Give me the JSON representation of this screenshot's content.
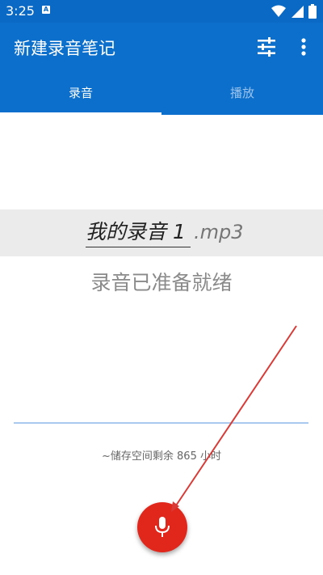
{
  "status_bar": {
    "time": "3:25",
    "notification_icon": "a-badge-icon",
    "icons": [
      "wifi-icon",
      "signal-icon",
      "battery-icon"
    ]
  },
  "app_bar": {
    "title": "新建录音笔记",
    "actions": [
      "tune-icon",
      "more-vert-icon"
    ]
  },
  "tabs": [
    {
      "label": "录音",
      "selected": true
    },
    {
      "label": "播放",
      "selected": false
    }
  ],
  "recorder": {
    "filename": "我的录音 1",
    "extension": ".mp3",
    "status": "录音已准备就绪",
    "storage_remaining": "~储存空间剩余 865 小时"
  },
  "colors": {
    "primary": "#0b6fcb",
    "record_button": "#e1261c",
    "annotation_arrow": "#d93a36"
  }
}
